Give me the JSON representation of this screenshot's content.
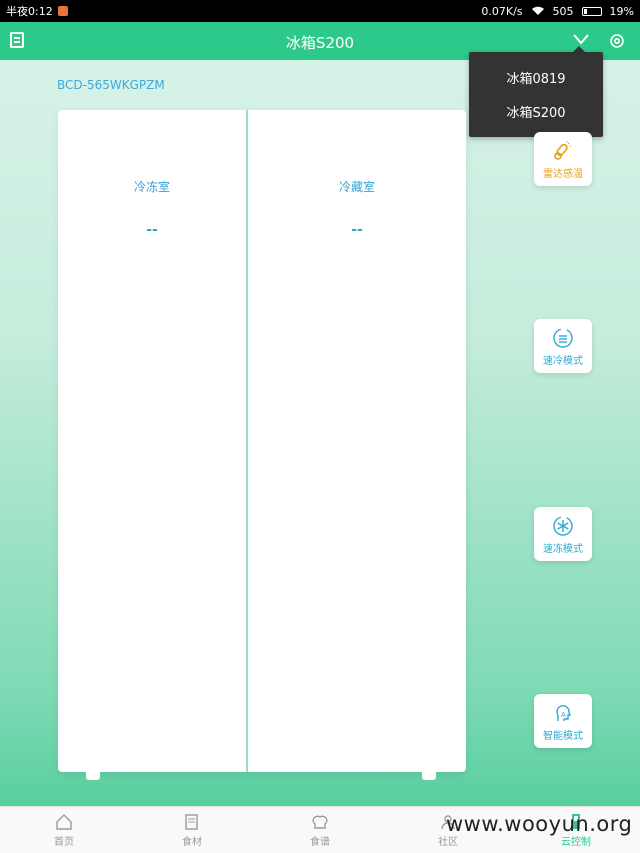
{
  "status": {
    "carrier_time": "半夜0:12",
    "speed": "0.07K/s",
    "signal": "505",
    "battery": "19%"
  },
  "header": {
    "title": "冰箱S200"
  },
  "dropdown": {
    "options": [
      "冰箱0819",
      "冰箱S200"
    ]
  },
  "model": "BCD-565WKGPZM",
  "fridge": {
    "compartments": [
      {
        "name": "冷冻室",
        "temp": "--"
      },
      {
        "name": "冷藏室",
        "temp": "--"
      }
    ]
  },
  "modes": [
    {
      "label": "雷达感温",
      "icon": "thermometer-icon"
    },
    {
      "label": "速冷模式",
      "icon": "fast-cool-icon"
    },
    {
      "label": "速冻模式",
      "icon": "snowflake-icon"
    },
    {
      "label": "智能模式",
      "icon": "smart-head-icon"
    }
  ],
  "tabs": [
    {
      "label": "首页",
      "icon": "home-icon"
    },
    {
      "label": "食材",
      "icon": "ingredients-icon"
    },
    {
      "label": "食谱",
      "icon": "chef-hat-icon"
    },
    {
      "label": "社区",
      "icon": "community-icon"
    },
    {
      "label": "云控制",
      "icon": "cloud-control-icon",
      "active": true
    }
  ],
  "watermark": "www.wooyun.org",
  "colors": {
    "accent": "#2dc98a",
    "label_blue": "#3aa0d8",
    "radar_orange": "#e6a215"
  }
}
